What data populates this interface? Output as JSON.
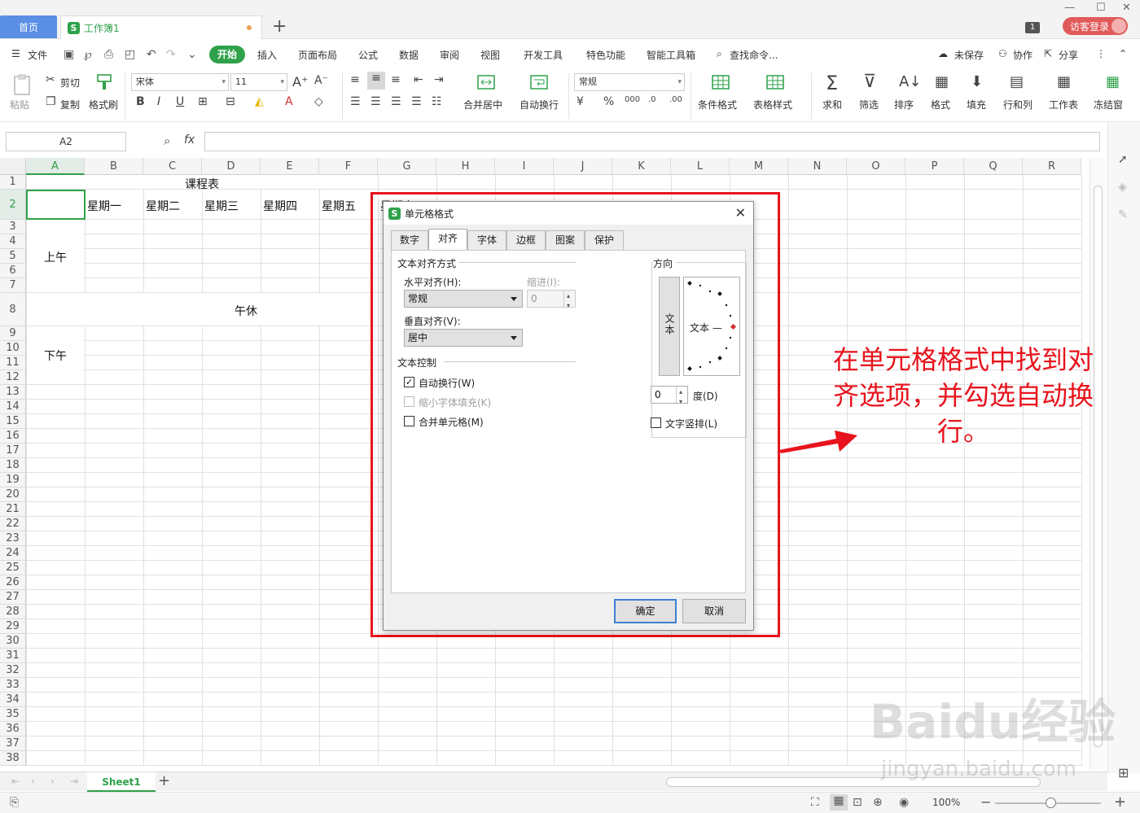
{
  "titlebar": {
    "home_tab": "首页",
    "doc_tab": "工作簿1",
    "new_tab": "+",
    "window_count": "1",
    "visitor_login": "访客登录"
  },
  "menu": {
    "file": "文件",
    "start": "开始",
    "items": [
      "插入",
      "页面布局",
      "公式",
      "数据",
      "审阅",
      "视图",
      "开发工具",
      "特色功能",
      "智能工具箱"
    ],
    "search": "查找命令...",
    "unsaved": "未保存",
    "collab": "协作",
    "share": "分享"
  },
  "ribbon": {
    "paste": "粘贴",
    "cut": "剪切",
    "copy": "复制",
    "format_painter": "格式刷",
    "font_name": "宋体",
    "font_size": "11",
    "merge_center": "合并居中",
    "auto_wrap": "自动换行",
    "number_format": "常规",
    "cond_format": "条件格式",
    "table_style": "表格样式",
    "sum": "求和",
    "filter": "筛选",
    "sort": "排序",
    "format": "格式",
    "fill": "填充",
    "row_col": "行和列",
    "worksheet": "工作表",
    "freeze": "冻结窗"
  },
  "formula_bar": {
    "cell_ref": "A2",
    "fx": "fx"
  },
  "grid": {
    "columns": [
      "A",
      "B",
      "C",
      "D",
      "E",
      "F",
      "G",
      "H",
      "I",
      "J",
      "K",
      "L",
      "M",
      "N",
      "O",
      "P",
      "Q",
      "R"
    ],
    "rows": [
      "1",
      "2",
      "3",
      "4",
      "5",
      "6",
      "7",
      "8",
      "9",
      "10",
      "11",
      "12",
      "13",
      "14",
      "15",
      "16",
      "17",
      "18",
      "19",
      "20",
      "21",
      "22",
      "23",
      "24",
      "25",
      "26",
      "27",
      "28",
      "29",
      "30",
      "31",
      "32",
      "33",
      "34",
      "35",
      "36",
      "37",
      "38"
    ],
    "title": "课程表",
    "weekdays": [
      "星期一",
      "星期二",
      "星期三",
      "星期四",
      "星期五",
      "星期六"
    ],
    "morning": "上午",
    "noon_break": "午休",
    "afternoon": "下午"
  },
  "sheets": {
    "active": "Sheet1",
    "add": "+"
  },
  "status": {
    "zoom": "100%"
  },
  "dialog": {
    "title": "单元格格式",
    "tabs": [
      "数字",
      "对齐",
      "字体",
      "边框",
      "图案",
      "保护"
    ],
    "active_tab": "对齐",
    "text_align_group": "文本对齐方式",
    "horizontal_label": "水平对齐(H):",
    "horizontal_value": "常规",
    "indent_label": "缩进(I):",
    "indent_value": "0",
    "vertical_label": "垂直对齐(V):",
    "vertical_value": "居中",
    "text_control_group": "文本控制",
    "auto_wrap": "自动换行(W)",
    "auto_wrap_checked": true,
    "shrink_to_fit": "缩小字体填充(K)",
    "merge_cells": "合并单元格(M)",
    "direction_group": "方向",
    "vertical_text": "文本",
    "dial_text": "文本 —",
    "degree_value": "0",
    "degree_label": "度(D)",
    "text_vertical": "文字竖排(L)",
    "ok": "确定",
    "cancel": "取消"
  },
  "annotation": {
    "text": "在单元格格式中找到对齐选项，并勾选自动换行。",
    "color": "#e8131c"
  },
  "watermark": {
    "brand": "Baidu经验",
    "url": "jingyan.baidu.com"
  }
}
